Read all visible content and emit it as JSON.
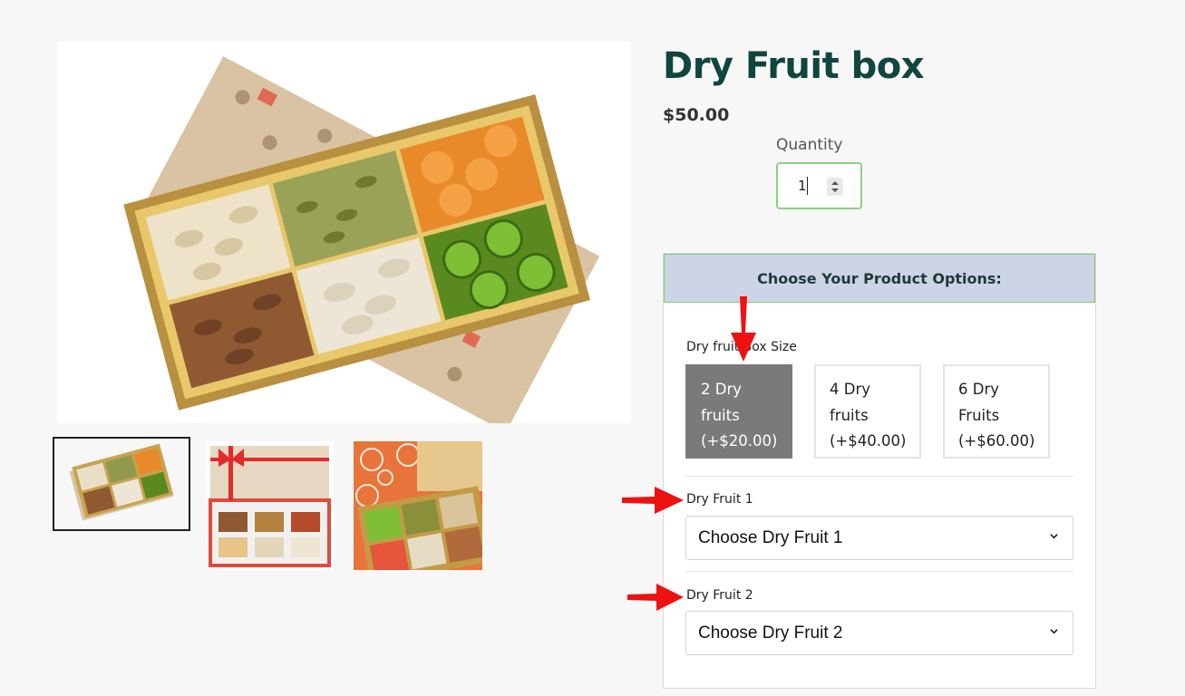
{
  "product": {
    "title": "Dry Fruit box",
    "price": "$50.00",
    "quantity_label": "Quantity",
    "quantity_value": "1"
  },
  "gallery": {
    "main_image": "dry-fruit-box-gold-tray",
    "thumbnails": [
      "dry-fruit-box-gold-tray",
      "dry-fruit-box-red-ribbon",
      "dry-fruit-box-orange-pattern"
    ],
    "selected_index": 0
  },
  "options": {
    "header": "Choose Your Product Options:",
    "size": {
      "label": "Dry fruit Box Size",
      "choices": [
        {
          "line1": "2 Dry",
          "line2": "fruits",
          "line3": "(+$20.00)",
          "selected": true
        },
        {
          "line1": "4 Dry",
          "line2": "fruits",
          "line3": "(+$40.00)",
          "selected": false
        },
        {
          "line1": "6 Dry",
          "line2": "Fruits",
          "line3": "(+$60.00)",
          "selected": false
        }
      ]
    },
    "fruit1": {
      "label": "Dry Fruit 1",
      "value": "Choose Dry Fruit 1"
    },
    "fruit2": {
      "label": "Dry Fruit 2",
      "value": "Choose Dry Fruit 2"
    }
  },
  "annotations": {
    "arrow_color": "#ee1111",
    "arrows": [
      "down-arrow-size",
      "right-arrow-fruit1",
      "right-arrow-fruit2"
    ]
  },
  "colors": {
    "title": "#11453f",
    "header_bg": "#cdd4e6",
    "header_border": "#7ccf6e",
    "selected_bg": "#7a7a7a"
  }
}
